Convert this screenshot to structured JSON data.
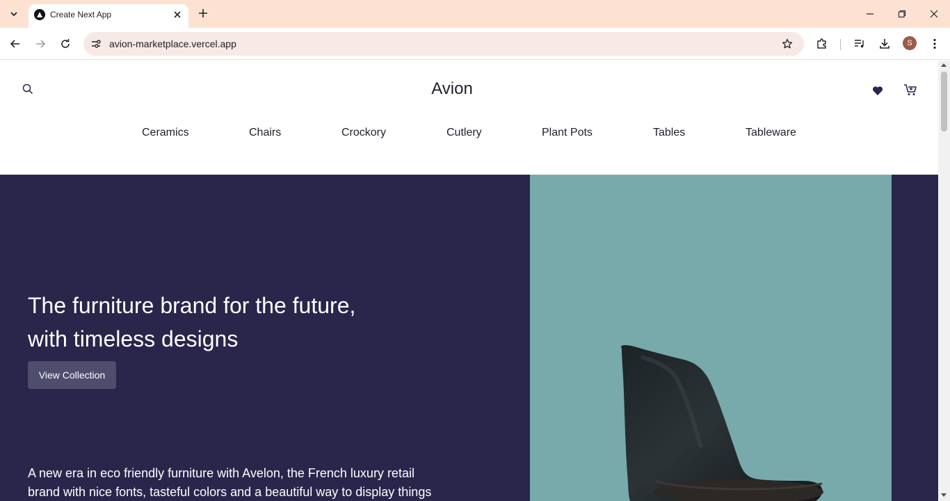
{
  "browser": {
    "tab_title": "Create Next App",
    "url": "avion-marketplace.vercel.app",
    "profile_initial": "S"
  },
  "site": {
    "brand": "Avion",
    "nav": [
      "Ceramics",
      "Chairs",
      "Crockory",
      "Cutlery",
      "Plant Pots",
      "Tables",
      "Tableware"
    ],
    "hero": {
      "title": "The furniture brand for the future, with timeless designs",
      "button_label": "View Collection",
      "description": "A new era in eco friendly furniture with Avelon, the French luxury retail brand with nice fonts, tasteful colors and a beautiful way to display things"
    }
  },
  "icons": {
    "tab_search": "chevron-down-icon",
    "tab_close": "close-icon",
    "new_tab": "plus-icon",
    "back": "arrow-left-icon",
    "forward": "arrow-right-icon",
    "reload": "reload-icon",
    "site_info": "tune-icon",
    "bookmark": "star-icon",
    "extensions": "puzzle-icon",
    "media": "media-control-icon",
    "downloads": "download-icon",
    "menu": "kebab-menu-icon",
    "site_search": "search-icon",
    "wishlist": "heart-icon",
    "cart": "cart-icon"
  },
  "colors": {
    "tabstrip": "#fde2d2",
    "hero_background": "#2a254b",
    "hero_button": "#4e4d6d",
    "hero_image_background": "#78aaab",
    "brand_text": "#22202e"
  }
}
